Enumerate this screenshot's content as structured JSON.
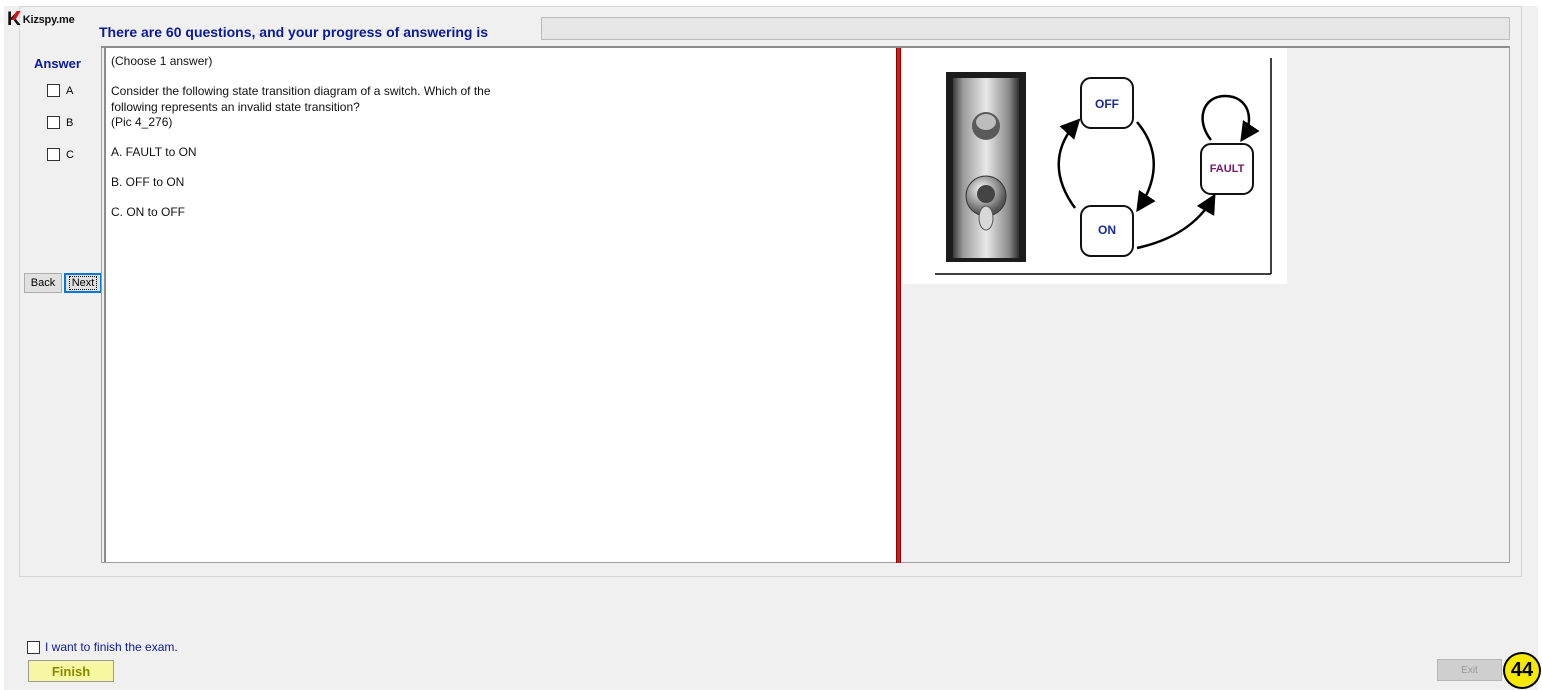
{
  "header": {
    "logo_text": "Kizspy.me",
    "progress_label": "There are 60 questions, and your progress of answering is"
  },
  "progress": {
    "value": 0
  },
  "answer_panel": {
    "title": "Answer",
    "options": [
      "A",
      "B",
      "C"
    ]
  },
  "nav": {
    "back_label": "Back",
    "next_label": "Next"
  },
  "question": {
    "type_note": "(Choose 1 answer)",
    "line1": "Consider the following state transition diagram of a switch. Which of the",
    "line2": "following represents an invalid state transition?",
    "pic_ref": "(Pic 4_276)",
    "choice_a": "A.  FAULT to ON",
    "choice_b": "B.  OFF to ON",
    "choice_c": "C.  ON to OFF"
  },
  "diagram": {
    "state_off": "OFF",
    "state_on": "ON",
    "state_fault": "FAULT"
  },
  "footer": {
    "finish_checkbox_label": "I want to finish the exam.",
    "finish_label": "Finish",
    "exit_label": "Exit",
    "question_number": "44"
  },
  "colors": {
    "accent": "#0a1a9c",
    "divider": "#d61a1a",
    "finish_bg": "#f7f7a3",
    "badge": "#f5e900"
  }
}
